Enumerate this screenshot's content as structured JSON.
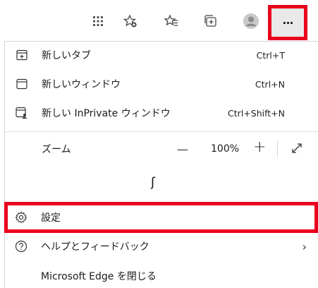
{
  "menu": {
    "items": [
      {
        "label": "新しいタブ",
        "shortcut": "Ctrl+T"
      },
      {
        "label": "新しいウィンドウ",
        "shortcut": "Ctrl+N"
      },
      {
        "label": "新しい InPrivate ウィンドウ",
        "shortcut": "Ctrl+Shift+N"
      }
    ],
    "zoom": {
      "label": "ズーム",
      "minus": "—",
      "value": "100%",
      "plus": "+"
    },
    "gap_symbol": "ʃ",
    "settings": {
      "label": "設定"
    },
    "help": {
      "label": "ヘルプとフィードバック",
      "chevron": "›"
    },
    "close": {
      "label": "Microsoft Edge を閉じる"
    }
  },
  "toolbar": {
    "more_label": "···"
  },
  "colors": {
    "highlight": "#e8001c",
    "more_bg": "#e9e9e9"
  }
}
